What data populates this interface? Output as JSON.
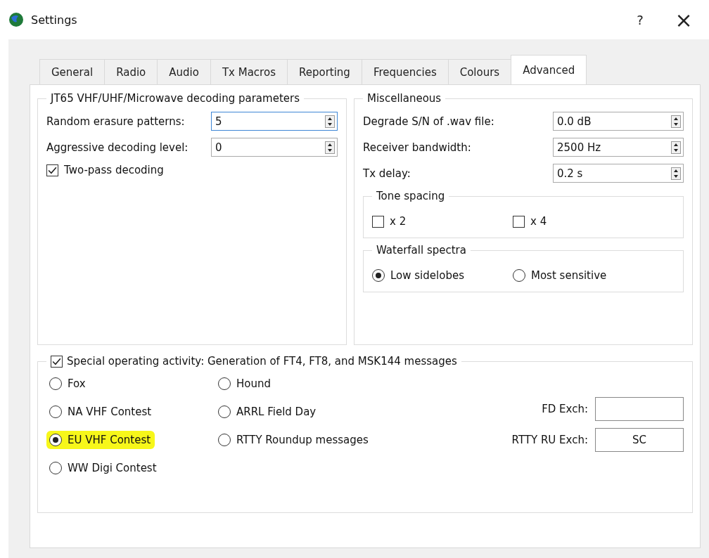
{
  "window": {
    "title": "Settings",
    "help": "?",
    "close": "×"
  },
  "tabs": [
    {
      "label": "General",
      "selected": false
    },
    {
      "label": "Radio",
      "selected": false
    },
    {
      "label": "Audio",
      "selected": false
    },
    {
      "label": "Tx Macros",
      "selected": false
    },
    {
      "label": "Reporting",
      "selected": false
    },
    {
      "label": "Frequencies",
      "selected": false
    },
    {
      "label": "Colours",
      "selected": false
    },
    {
      "label": "Advanced",
      "selected": true
    }
  ],
  "decoding": {
    "title": "JT65 VHF/UHF/Microwave decoding parameters",
    "fields": [
      {
        "label": "Random erasure patterns:",
        "value": "5",
        "focused": true
      },
      {
        "label": "Aggressive decoding level:",
        "value": "0",
        "focused": false
      }
    ],
    "checkbox": {
      "label": "Two-pass decoding",
      "checked": true
    }
  },
  "misc": {
    "title": "Miscellaneous",
    "fields": [
      {
        "label": "Degrade S/N of .wav file:",
        "value": "0.0 dB",
        "focused": false
      },
      {
        "label": "Receiver bandwidth:",
        "value": "2500  Hz",
        "focused": false
      },
      {
        "label": "Tx delay:",
        "value": "0.2  s",
        "focused": false
      }
    ],
    "tone_spacing": {
      "title": "Tone spacing",
      "options": [
        {
          "label": "x 2",
          "checked": false
        },
        {
          "label": "x 4",
          "checked": false
        }
      ]
    },
    "waterfall": {
      "title": "Waterfall spectra",
      "options": [
        {
          "label": "Low sidelobes",
          "selected": true
        },
        {
          "label": "Most sensitive",
          "selected": false
        }
      ]
    }
  },
  "activity": {
    "label": "Special operating activity:  Generation of FT4, FT8, and MSK144 messages",
    "checked": true,
    "columns": [
      {
        "options": [
          {
            "label": "Fox",
            "selected": false,
            "highlighted": false
          },
          {
            "label": "NA VHF Contest",
            "selected": false,
            "highlighted": false
          },
          {
            "label": "EU VHF Contest",
            "selected": true,
            "highlighted": true
          },
          {
            "label": "WW Digi Contest",
            "selected": false,
            "highlighted": false
          }
        ]
      },
      {
        "options": [
          {
            "label": "Hound",
            "selected": false,
            "highlighted": false
          },
          {
            "label": "ARRL Field Day",
            "selected": false,
            "highlighted": false
          },
          {
            "label": "RTTY Roundup messages",
            "selected": false,
            "highlighted": false
          }
        ]
      }
    ],
    "exchanges": [
      {
        "label": "FD Exch:"
      },
      {
        "label": "RTTY RU Exch:",
        "value": "SC"
      }
    ]
  }
}
